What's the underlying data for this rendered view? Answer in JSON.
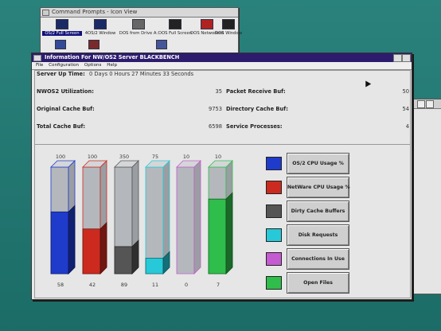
{
  "icon_window": {
    "title": "Command Prompts - Icon View",
    "items": [
      {
        "label": "OS/2 Full Screen",
        "selected": true
      },
      {
        "label": "4OS/2 Window",
        "selected": false
      },
      {
        "label": "DOS from Drive A:",
        "selected": false
      },
      {
        "label": "DOS Full Screen",
        "selected": false
      },
      {
        "label": "DOS Networked",
        "selected": false
      },
      {
        "label": "DOS Window",
        "selected": false
      }
    ]
  },
  "main_window": {
    "title": "Information For NW/OS2 Server BLACKBENCH",
    "menu": [
      "File",
      "Configuration",
      "Options",
      "Help"
    ]
  },
  "stats": {
    "uptime_label": "Server Up Time:",
    "uptime_value": "0 Days  0 Hours 27 Minutes 33 Seconds",
    "nwos2_util_label": "NWOS2 Utilization:",
    "nwos2_util_value": "35",
    "packet_receive_label": "Packet Receive Buf:",
    "packet_receive_value": "50",
    "original_cache_label": "Original Cache Buf:",
    "original_cache_value": "9753",
    "directory_cache_label": "Directory Cache Buf:",
    "directory_cache_value": "54",
    "total_cache_label": "Total Cache Buf:",
    "total_cache_value": "6598",
    "service_processes_label": "Service Processes:",
    "service_processes_value": "4"
  },
  "chart_data": {
    "type": "bar",
    "categories": [
      "OS/2 CPU Usage %",
      "NetWare CPU Usage %",
      "Dirty Cache Buffers",
      "Disk Requests",
      "Connections In Use",
      "Open Files"
    ],
    "maxima": [
      100,
      100,
      350,
      75,
      10,
      10
    ],
    "values": [
      58,
      42,
      89,
      11,
      0,
      7
    ],
    "max_labels": [
      "100",
      "100",
      "350",
      "75",
      "10",
      "10"
    ],
    "value_labels": [
      "58",
      "42",
      "89",
      "11",
      "0",
      "7"
    ],
    "colors": [
      "#1f3bcc",
      "#cc2a1e",
      "#555555",
      "#27c9d8",
      "#c55bd0",
      "#2fbe4b"
    ]
  }
}
